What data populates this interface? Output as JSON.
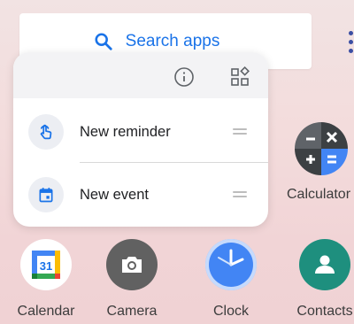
{
  "search": {
    "label": "Search apps"
  },
  "popup": {
    "shortcuts": [
      {
        "label": "New reminder",
        "icon": "reminder-hand-icon"
      },
      {
        "label": "New event",
        "icon": "calendar-event-icon"
      }
    ]
  },
  "apps": {
    "calendar": "Calendar",
    "camera": "Camera",
    "clock": "Clock",
    "contacts": "Contacts",
    "calculator": "Calculator"
  },
  "colors": {
    "accent": "#1a73e8",
    "contacts": "#1e8f7e",
    "clock": "#4285f4",
    "camera": "#616161",
    "calculator_dark": "#5f6368"
  }
}
